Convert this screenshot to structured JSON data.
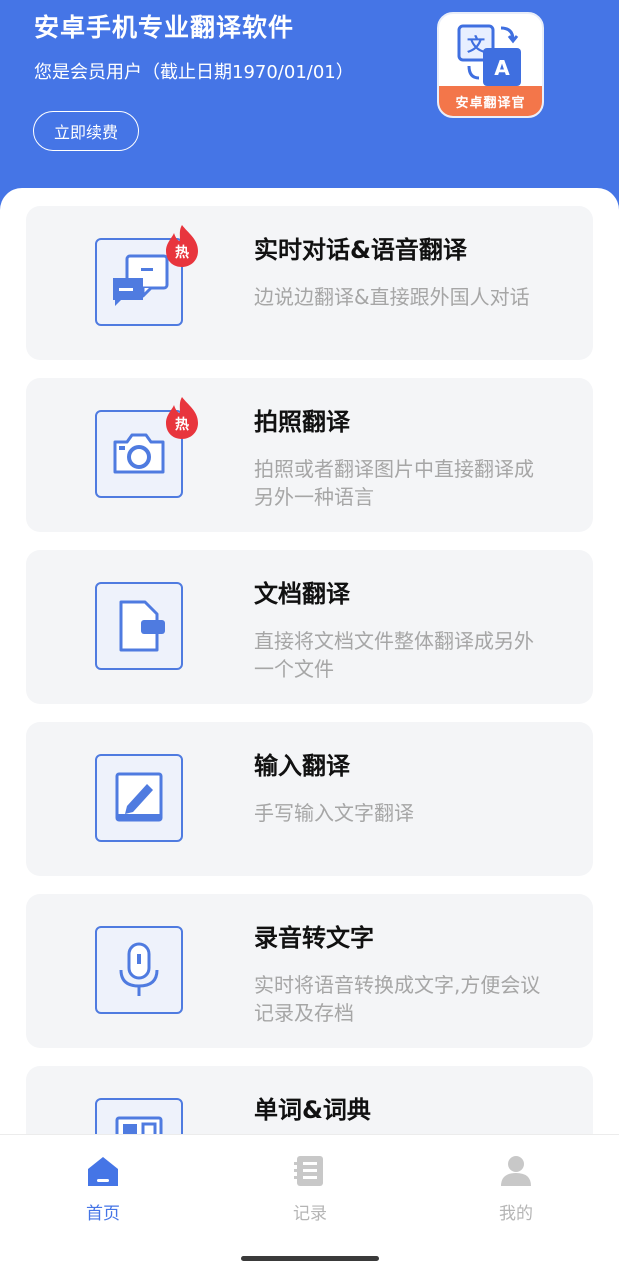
{
  "header": {
    "title": "安卓手机专业翻译软件",
    "member_status": "您是会员用户（截止日期1970/01/01）",
    "renew_label": "立即续费",
    "logo_text": "安卓翻译官",
    "logo_glyph_zh": "文",
    "logo_glyph_en": "A"
  },
  "features": [
    {
      "title": "实时对话&语音翻译",
      "desc": "边说边翻译&直接跟外国人对话",
      "badge": "热",
      "icon": "chat-bubbles-icon"
    },
    {
      "title": "拍照翻译",
      "desc": "拍照或者翻译图片中直接翻译成另外一种语言",
      "badge": "热",
      "icon": "camera-icon"
    },
    {
      "title": "文档翻译",
      "desc": "直接将文档文件整体翻译成另外一个文件",
      "icon": "document-icon"
    },
    {
      "title": "输入翻译",
      "desc": "手写输入文字翻译",
      "icon": "handwrite-icon"
    },
    {
      "title": "录音转文字",
      "desc": "实时将语音转换成文字,方便会议记录及存档",
      "icon": "microphone-icon"
    },
    {
      "title": "单词&词典",
      "icon": "dictionary-icon"
    }
  ],
  "tabs": [
    {
      "label": "首页",
      "icon": "home-icon",
      "active": true
    },
    {
      "label": "记录",
      "icon": "records-icon",
      "active": false
    },
    {
      "label": "我的",
      "icon": "profile-icon",
      "active": false
    }
  ],
  "colors": {
    "primary": "#4575e6",
    "icon_stroke": "#4f7be0",
    "hot_badge": "#e8353d",
    "inactive": "#b5b5b5",
    "card_bg": "#f4f5f7"
  }
}
